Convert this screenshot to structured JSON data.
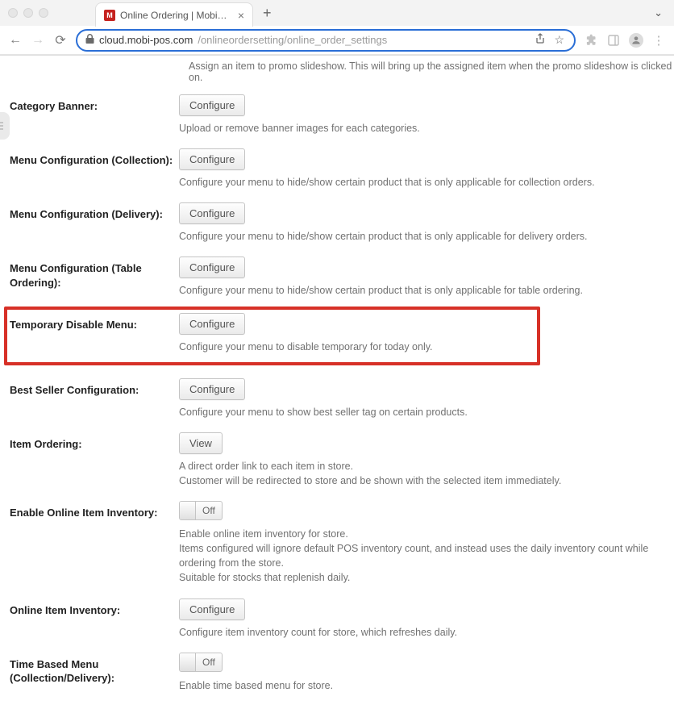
{
  "browser": {
    "tab_title": "Online Ordering | MobiPOS",
    "tab_favicon_letter": "M",
    "url_host": "cloud.mobi-pos.com",
    "url_path": "/onlineordersetting/online_order_settings"
  },
  "partial_top_desc": "Assign an item to promo slideshow. This will bring up the assigned item when the promo slideshow is clicked on.",
  "buttons": {
    "configure": "Configure",
    "view": "View",
    "off": "Off"
  },
  "rows": [
    {
      "id": "category-banner",
      "label": "Category Banner:",
      "control": "configure",
      "desc": "Upload or remove banner images for each categories."
    },
    {
      "id": "menu-config-collection",
      "label": "Menu Configuration (Collection):",
      "control": "configure",
      "desc": "Configure your menu to hide/show certain product that is only applicable for collection orders."
    },
    {
      "id": "menu-config-delivery",
      "label": "Menu Configuration (Delivery):",
      "control": "configure",
      "desc": "Configure your menu to hide/show certain product that is only applicable for delivery orders."
    },
    {
      "id": "menu-config-table",
      "label": "Menu Configuration (Table Ordering):",
      "control": "configure",
      "desc": "Configure your menu to hide/show certain product that is only applicable for table ordering."
    },
    {
      "id": "temporary-disable-menu",
      "label": "Temporary Disable Menu:",
      "control": "configure",
      "desc": "Configure your menu to disable temporary for today only.",
      "highlight": true
    },
    {
      "id": "best-seller-config",
      "label": "Best Seller Configuration:",
      "control": "configure",
      "desc": "Configure your menu to show best seller tag on certain products."
    },
    {
      "id": "item-ordering",
      "label": "Item Ordering:",
      "control": "view",
      "desc": "A direct order link to each item in store.\nCustomer will be redirected to store and be shown with the selected item immediately."
    },
    {
      "id": "enable-online-item-inventory",
      "label": "Enable Online Item Inventory:",
      "control": "toggle-off",
      "desc": "Enable online item inventory for store.\nItems configured will ignore default POS inventory count, and instead uses the daily inventory count while ordering from the store.\nSuitable for stocks that replenish daily."
    },
    {
      "id": "online-item-inventory",
      "label": "Online Item Inventory:",
      "control": "configure",
      "desc": "Configure item inventory count for store, which refreshes daily."
    },
    {
      "id": "time-based-menu",
      "label": "Time Based Menu (Collection/Delivery):",
      "control": "toggle-off",
      "desc": "Enable time based menu for store."
    }
  ]
}
